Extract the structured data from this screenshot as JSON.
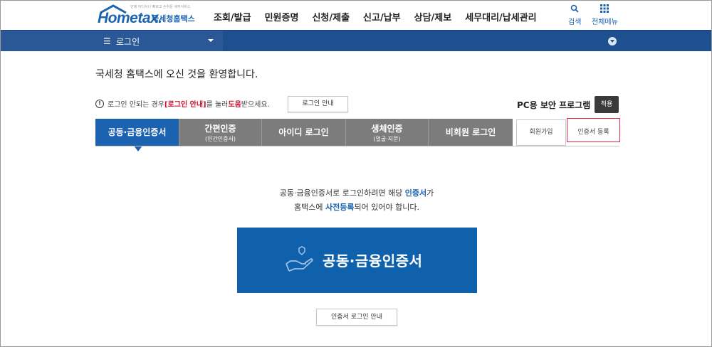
{
  "header": {
    "logo_slogan": "언제 어디서나 빠르고 손쉬운 세무서비스",
    "logo_brand": "Hometax.",
    "logo_brand_kr": "국세청홈택스",
    "nav": [
      "조회/발급",
      "민원증명",
      "신청/제출",
      "신고/납부",
      "상담/제보",
      "세무대리/납세관리"
    ],
    "search_label": "검색",
    "menu_label": "전체메뉴"
  },
  "navbar": {
    "current": "로그인"
  },
  "welcome": "국세청 홈택스에 오신 것을 환영합니다.",
  "notice": {
    "prefix": "로그인 안되는 경우 ",
    "link": "[로그인 안내]",
    "mid": "를 눌러 ",
    "help": "도움",
    "suffix": "받으세요.",
    "guide_button": "로그인 안내"
  },
  "security": {
    "label": "PC용 보안 프로그램",
    "apply_button": "적용"
  },
  "tabs": [
    {
      "label": "공동·금융인증서",
      "sub": "",
      "active": true
    },
    {
      "label": "간편인증",
      "sub": "(민간인증서)",
      "active": false
    },
    {
      "label": "아이디 로그인",
      "sub": "",
      "active": false
    },
    {
      "label": "생체인증",
      "sub": "(얼굴·지문)",
      "active": false
    },
    {
      "label": "비회원 로그인",
      "sub": "",
      "active": false
    }
  ],
  "side_buttons": {
    "signup": "회원가입",
    "cert_register": "인증서 등록"
  },
  "description": {
    "line1_prefix": "공동·금융인증서로 로그인하려면 해당 ",
    "line1_highlight": "인증서",
    "line1_suffix": "가",
    "line2_prefix": "홈택스에 ",
    "line2_highlight": "사전등록",
    "line2_suffix": "되어 있어야 합니다."
  },
  "cert_button": "공동·금융인증서",
  "cert_guide_button": "인증서 로그인 안내",
  "colors": {
    "brand_blue": "#1b63b0",
    "navbar": "#1e4f8e",
    "tab_inactive": "#7c7c7c",
    "highlight": "#e8234a",
    "red_text": "#c8102e"
  }
}
